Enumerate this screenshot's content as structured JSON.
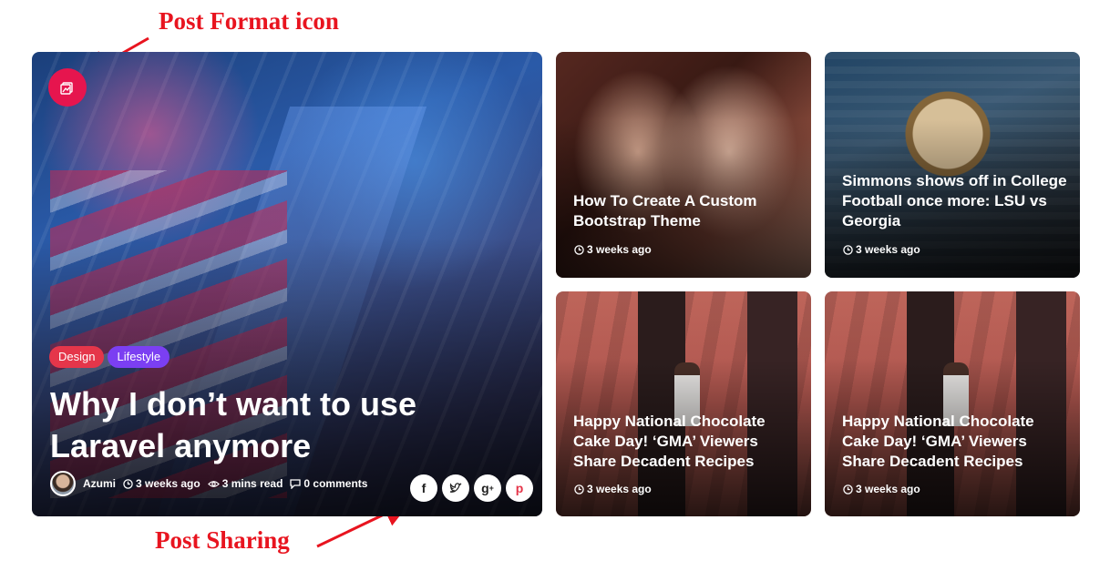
{
  "annotations": {
    "post_format": "Post Format icon",
    "post_sharing": "Post Sharing"
  },
  "colors": {
    "annotation_red": "#e8141f",
    "format_badge": "#e6154e",
    "tag_design": "#e5364a",
    "tag_lifestyle": "#7b3ff2"
  },
  "main_post": {
    "format_icon": "image-gallery-icon",
    "tags": [
      "Design",
      "Lifestyle"
    ],
    "title": "Why I don’t want to use Laravel anymore",
    "author": "Azumi",
    "time": "3 weeks ago",
    "read_time": "3 mins read",
    "comments": "0 comments",
    "share_icons": [
      "facebook-icon",
      "twitter-icon",
      "google-plus-icon",
      "pinterest-icon"
    ]
  },
  "cards": [
    {
      "title": "How To Create A Custom Bootstrap Theme",
      "time": "3 weeks ago"
    },
    {
      "title": "Simmons shows off in College Football once more: LSU vs Georgia",
      "time": "3 weeks ago"
    },
    {
      "title": "Happy National Chocolate Cake Day! ‘GMA’ Viewers Share Decadent Recipes",
      "time": "3 weeks ago"
    },
    {
      "title": "Happy National Chocolate Cake Day! ‘GMA’ Viewers Share Decadent Recipes",
      "time": "3 weeks ago"
    }
  ]
}
